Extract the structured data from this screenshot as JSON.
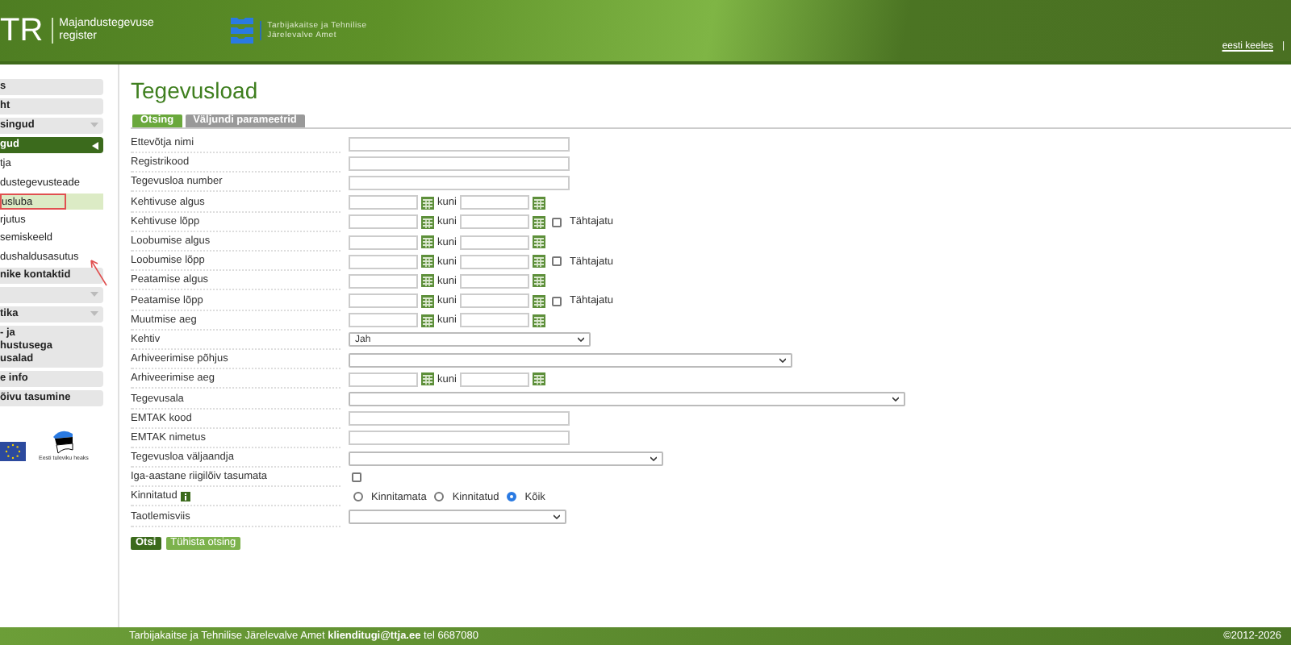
{
  "header": {
    "brand_mark": "TR",
    "brand_name": "Majandustegevuse register",
    "agency": "Tarbijakaitse ja Tehnilise Järelevalve Amet",
    "language_link": "eesti keeles",
    "separator": "|"
  },
  "sidebar": {
    "items": [
      {
        "kind": "link",
        "label": "s",
        "selected": false
      },
      {
        "kind": "link",
        "label": "ht",
        "selected": false
      },
      {
        "kind": "group",
        "label": "singud",
        "expanded": false
      },
      {
        "kind": "group",
        "label": "gud",
        "expanded": true
      },
      {
        "kind": "sub",
        "label": "tja",
        "selected": false
      },
      {
        "kind": "sub",
        "label": "dustegevusteade",
        "selected": false
      },
      {
        "kind": "sub",
        "label": "usluba",
        "selected": true,
        "annotated": true
      },
      {
        "kind": "sub",
        "label": "rjutus",
        "selected": false
      },
      {
        "kind": "sub",
        "label": "semiskeeld",
        "selected": false
      },
      {
        "kind": "sub",
        "label": "dushaldusasutus",
        "selected": false
      },
      {
        "kind": "link",
        "label": "nike kontaktid",
        "selected": false
      },
      {
        "kind": "group",
        "expanded": false
      },
      {
        "kind": "group",
        "label": "tika",
        "expanded": false
      },
      {
        "kind": "link",
        "label": "- ja\nhustusega\nusalad",
        "selected": false
      },
      {
        "kind": "link",
        "label": "e info",
        "selected": false
      },
      {
        "kind": "link",
        "label": "õivu tasumine",
        "selected": false
      }
    ],
    "logos": [
      {
        "kind": "eu"
      },
      {
        "kind": "estonia",
        "caption": "Eesti tuleviku heaks"
      }
    ]
  },
  "title": "Tegevusload",
  "tabs": [
    {
      "label": "Otsing",
      "selected": true
    },
    {
      "label": "Väljundi parameetrid",
      "selected": false
    }
  ],
  "form": [
    {
      "kind": "text",
      "label": "Ettevõtja nimi"
    },
    {
      "kind": "text",
      "label": "Registrikood"
    },
    {
      "kind": "text",
      "label": "Tegevusloa number"
    },
    {
      "kind": "daterange",
      "label": "Kehtivuse algus",
      "between": "kuni"
    },
    {
      "kind": "daterange",
      "label": "Kehtivuse lõpp",
      "between": "kuni",
      "option": {
        "label": "Tähtajatu",
        "checked": false
      }
    },
    {
      "kind": "daterange",
      "label": "Loobumise algus",
      "between": "kuni"
    },
    {
      "kind": "daterange",
      "label": "Loobumise lõpp",
      "between": "kuni",
      "option": {
        "label": "Tähtajatu",
        "checked": false
      }
    },
    {
      "kind": "daterange",
      "label": "Peatamise algus",
      "between": "kuni"
    },
    {
      "kind": "daterange",
      "label": "Peatamise lõpp",
      "between": "kuni",
      "option": {
        "label": "Tähtajatu",
        "checked": false
      }
    },
    {
      "kind": "daterange",
      "label": "Muutmise aeg",
      "between": "kuni"
    },
    {
      "kind": "select",
      "label": "Kehtiv",
      "value": "Jah"
    },
    {
      "kind": "select",
      "label": "Arhiveerimise põhjus"
    },
    {
      "kind": "daterange",
      "label": "Arhiveerimise aeg",
      "between": "kuni"
    },
    {
      "kind": "select",
      "label": "Tegevusala"
    },
    {
      "kind": "text",
      "label": "EMTAK kood"
    },
    {
      "kind": "text",
      "label": "EMTAK nimetus"
    },
    {
      "kind": "select",
      "label": "Tegevusloa väljaandja"
    },
    {
      "kind": "checkbox",
      "label": "Iga-aastane riigilõiv tasumata",
      "checked": false
    },
    {
      "kind": "radio",
      "label": "Kinnitatud",
      "info": true,
      "options": [
        {
          "label": "Kinnitamata",
          "selected": false
        },
        {
          "label": "Kinnitatud",
          "selected": false
        },
        {
          "label": "Kõik",
          "selected": true
        }
      ]
    },
    {
      "kind": "select",
      "label": "Taotlemisviis"
    }
  ],
  "buttons": [
    {
      "label": "Otsi",
      "kind": "primary"
    },
    {
      "label": "Tühista otsing",
      "kind": "secondary"
    }
  ],
  "footer": {
    "text": "Tarbijakaitse ja Tehnilise Järelevalve Amet **klienditugi@ttja.ee** tel 6687080",
    "copyright": "©2012-2026"
  }
}
